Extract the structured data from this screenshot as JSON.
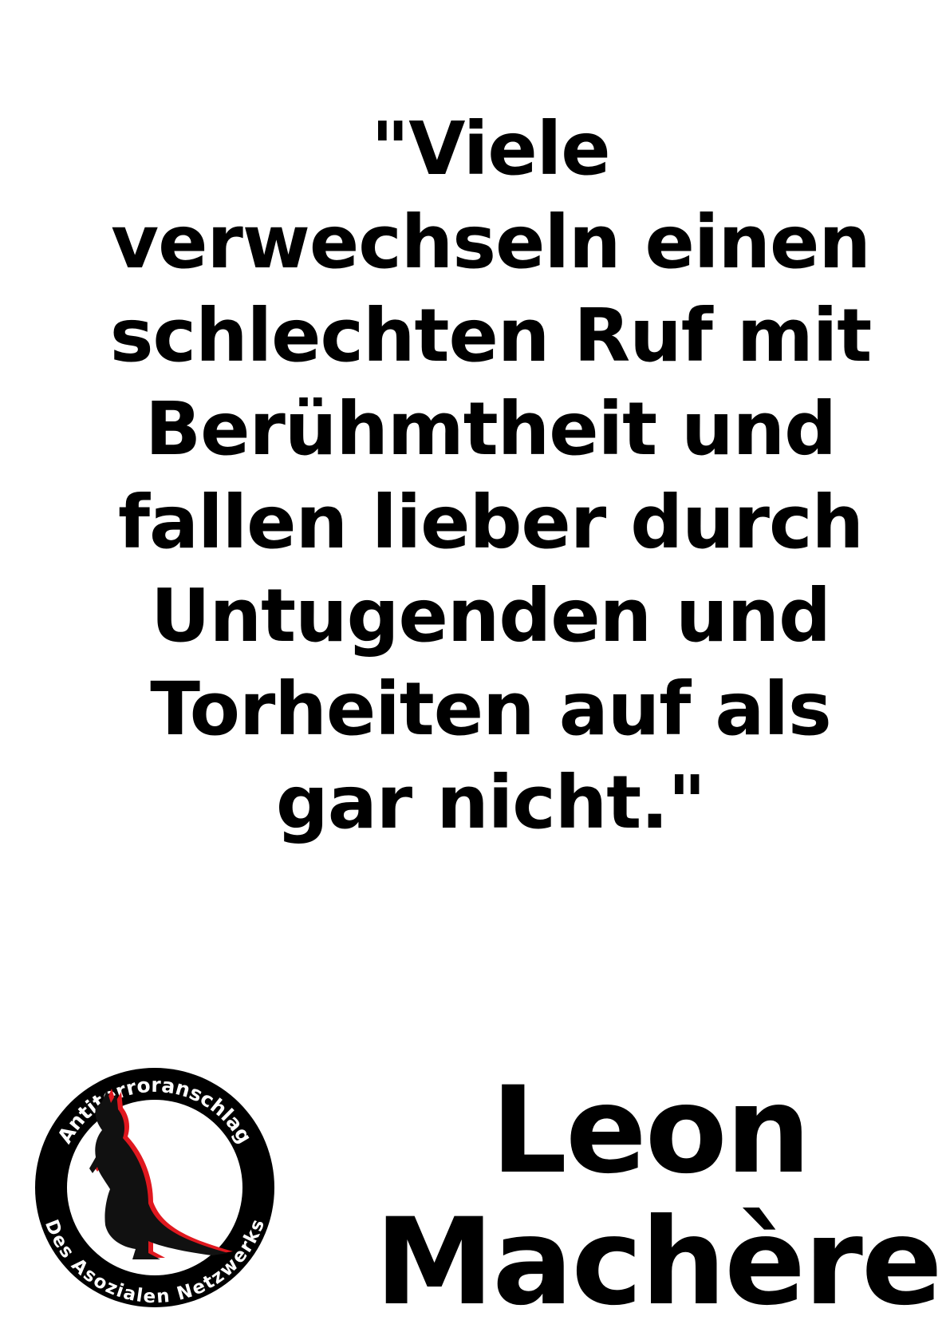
{
  "quote": {
    "lines": [
      "\"Viele",
      "verwechseln einen",
      "schlechten Ruf mit",
      "Berühmtheit und",
      "fallen lieber durch",
      "Untugenden und",
      "Torheiten auf als",
      "gar nicht.\""
    ]
  },
  "author": {
    "lines": [
      "Leon",
      "Machère"
    ]
  },
  "logo": {
    "top_text": "Antiterroranschlag",
    "bottom_text": "Des Asozialen Netzwerks",
    "icon": "kangaroo-icon",
    "colors": {
      "ring": "#000000",
      "kangaroo": "#111111",
      "accent": "#e0181f"
    }
  }
}
